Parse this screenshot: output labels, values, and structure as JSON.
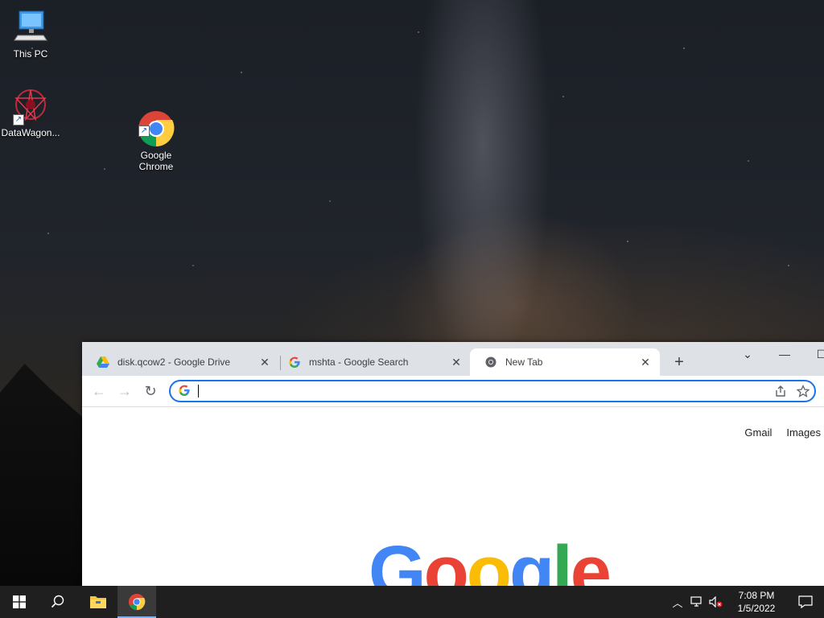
{
  "desktop": {
    "icons": [
      {
        "label": "This PC"
      },
      {
        "label": "DataWagon..."
      },
      {
        "label": "Google\nChrome"
      }
    ]
  },
  "chrome": {
    "tabs": [
      {
        "title": "disk.qcow2 - Google Drive",
        "favicon": "google-drive-icon"
      },
      {
        "title": "mshta - Google Search",
        "favicon": "google-g-icon"
      },
      {
        "title": "New Tab",
        "favicon": "chrome-icon",
        "active": true
      }
    ],
    "omnibox": {
      "value": "",
      "placeholder": ""
    },
    "content": {
      "links": [
        "Gmail",
        "Images"
      ],
      "logo": "Google"
    }
  },
  "taskbar": {
    "time": "7:08 PM",
    "date": "1/5/2022"
  },
  "colors": {
    "accent": "#1a73e8",
    "g_blue": "#4285f4",
    "g_red": "#ea4335",
    "g_yellow": "#fbbc05",
    "g_green": "#34a853"
  }
}
